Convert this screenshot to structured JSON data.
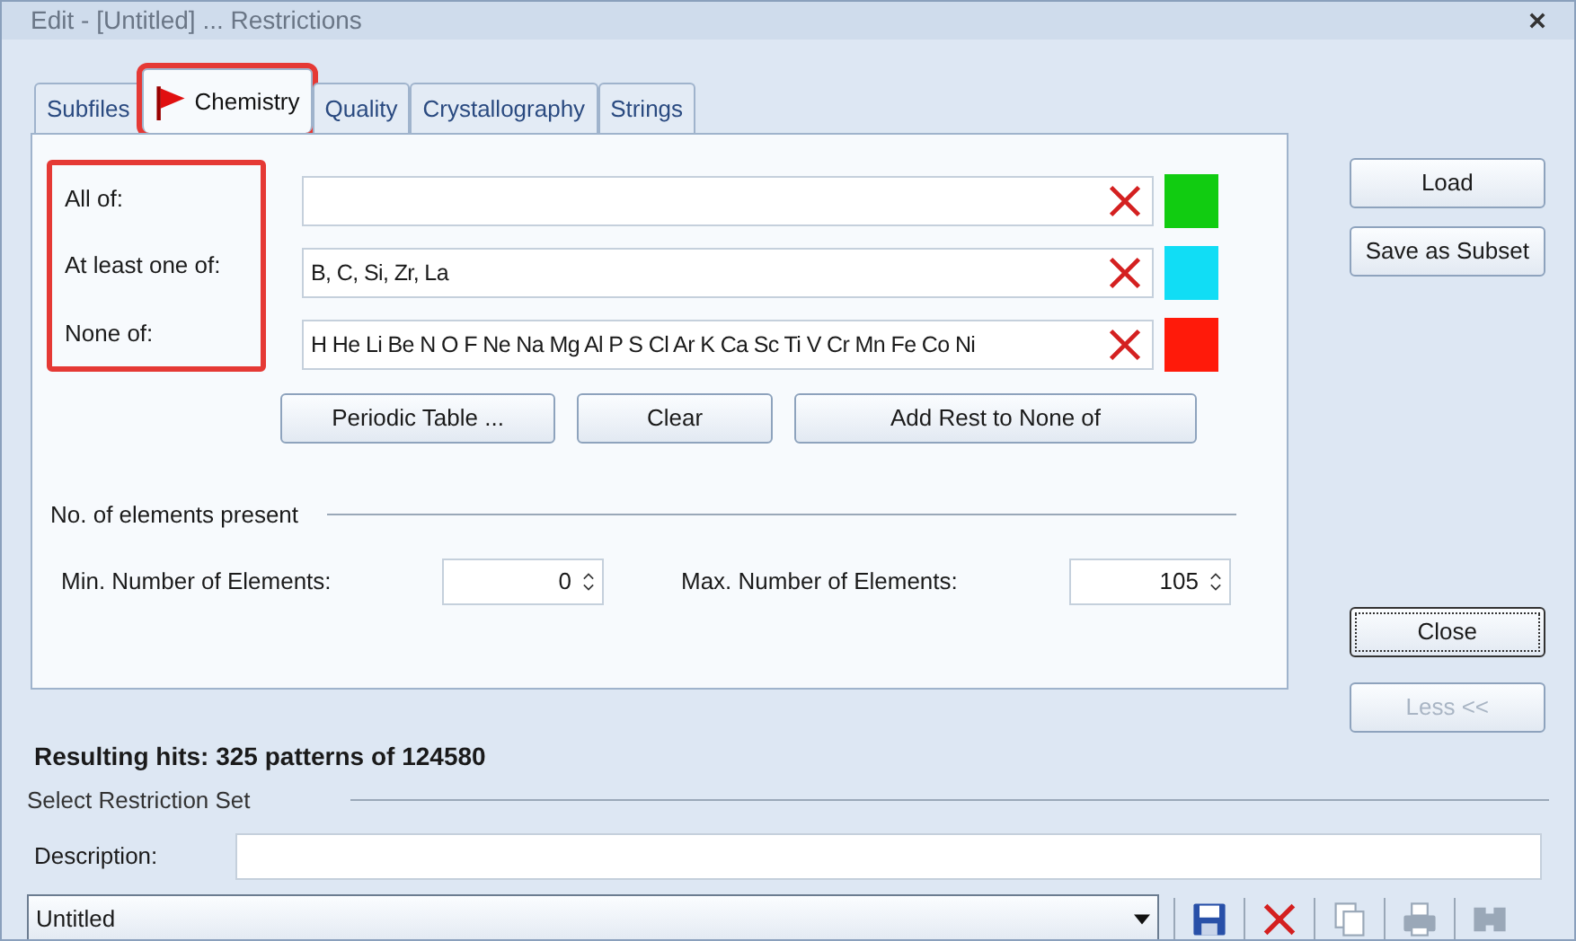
{
  "window": {
    "title": "Edit - [Untitled] ... Restrictions"
  },
  "tabs": [
    {
      "label": "Subfiles",
      "selected": false,
      "highlighted": false
    },
    {
      "label": "Chemistry",
      "selected": true,
      "highlighted": true
    },
    {
      "label": "Quality",
      "selected": false,
      "highlighted": false
    },
    {
      "label": "Crystallography",
      "selected": false,
      "highlighted": false
    },
    {
      "label": "Strings",
      "selected": false,
      "highlighted": false
    }
  ],
  "restriction_fields": {
    "highlighted": true,
    "rows": [
      {
        "label": "All of:",
        "color": "#11cc11"
      },
      {
        "label": "At least one of:",
        "value": "B, C, Si, Zr, La",
        "color": "#11ddf5"
      },
      {
        "label": "None of:",
        "value": "H He Li Be N O F Ne Na Mg Al P S Cl Ar K Ca Sc Ti V Cr Mn Fe Co Ni",
        "color": "#ff1a0a"
      }
    ]
  },
  "field_buttons": [
    "Periodic Table ...",
    "Clear",
    "Add Rest to None of"
  ],
  "count_group": {
    "title": "No. of elements present",
    "spinners": [
      {
        "label": "Min. Number of Elements:",
        "value": "0"
      },
      {
        "label": "Max. Number of Elements:",
        "value": "105"
      }
    ]
  },
  "side_buttons": [
    {
      "label": "Load",
      "default": false,
      "disabled": false
    },
    {
      "label": "Save as Subset",
      "default": false,
      "disabled": false
    },
    {
      "label": "Close",
      "default": true,
      "disabled": false
    },
    {
      "label": "Less <<",
      "default": false,
      "disabled": true
    }
  ],
  "result": "Resulting hits: 325 patterns of 124580",
  "restriction_set": {
    "title": "Select Restriction Set",
    "description_label": "Description:",
    "preset": "Untitled",
    "tools": [
      {
        "kind": "save",
        "disabled": false
      },
      {
        "kind": "delete",
        "disabled": false
      },
      {
        "kind": "copy",
        "disabled": true
      },
      {
        "kind": "print",
        "disabled": true
      },
      {
        "kind": "export",
        "disabled": true
      }
    ]
  }
}
